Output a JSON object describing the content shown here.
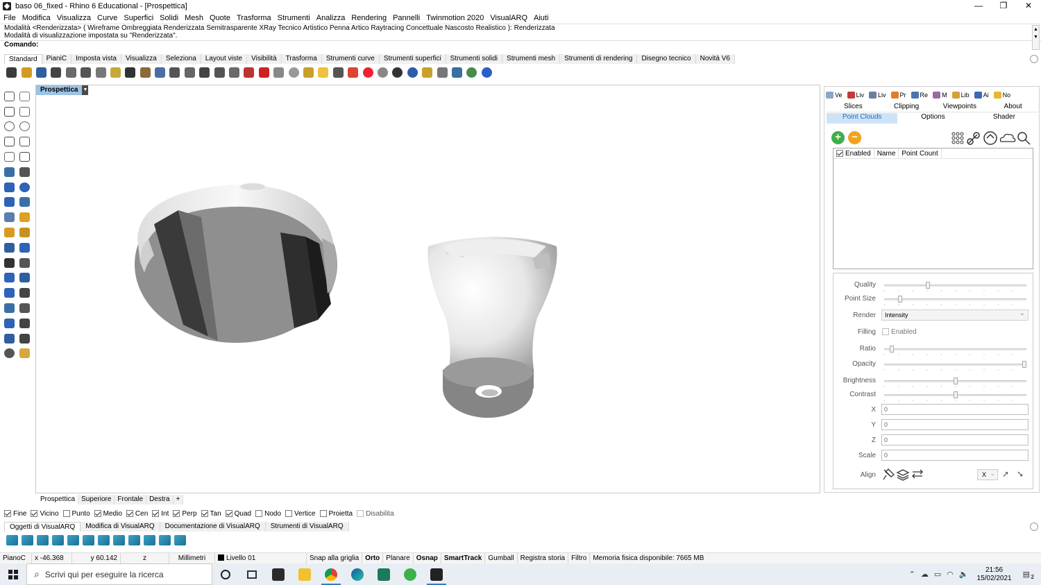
{
  "window": {
    "title": "baso 06_fixed - Rhino 6 Educational - [Prospettica]",
    "controls": [
      "—",
      "❐",
      "✕"
    ]
  },
  "menu": [
    "File",
    "Modifica",
    "Visualizza",
    "Curve",
    "Superfici",
    "Solidi",
    "Mesh",
    "Quote",
    "Trasforma",
    "Strumenti",
    "Analizza",
    "Rendering",
    "Pannelli",
    "Twinmotion 2020",
    "VisualARQ",
    "Aiuti"
  ],
  "command": {
    "history_line1": "Modalità <Renderizzata> ( Wireframe Ombreggiata Renderizzata Semitrasparente XRay Tecnico Artistico Penna Artico Raytracing Concettuale Nascosto Realistico ): Renderizzata",
    "history_line2": "Modalità di visualizzazione impostata su \"Renderizzata\".",
    "prompt": "Comando:"
  },
  "toolbar_tabs": [
    "Standard",
    "PianiC",
    "Imposta vista",
    "Visualizza",
    "Seleziona",
    "Layout viste",
    "Visibilità",
    "Trasforma",
    "Strumenti curve",
    "Strumenti superfici",
    "Strumenti solidi",
    "Strumenti mesh",
    "Strumenti di rendering",
    "Disegno tecnico",
    "Novità V6"
  ],
  "toolbar_icons": [
    "new-icon",
    "open-icon",
    "save-icon",
    "print-icon",
    "import-icon",
    "cut-icon",
    "copy-icon",
    "paste-icon",
    "undo-icon",
    "pan-icon",
    "move-view-icon",
    "zoom-icon",
    "zoom-window-icon",
    "zoom-extents-icon",
    "zoom-selected-icon",
    "rotate-view-icon",
    "grid-icon",
    "car-icon",
    "point-icon",
    "circle-icon",
    "light-icon",
    "bulb-icon",
    "lock-icon",
    "layer-icon",
    "color-wheel-icon",
    "sphere-gray-icon",
    "sphere-dark-icon",
    "sphere-blue-icon",
    "render-icon",
    "settings-icon",
    "gumball-icon",
    "globe-icon",
    "help-icon"
  ],
  "left_tool_icons": [
    "select-icon",
    "point-icon",
    "polyline-icon",
    "curve-icon",
    "circle-icon",
    "ellipse-icon",
    "triangle-icon",
    "rectangle-icon",
    "polygon-icon",
    "arc-icon",
    "box-edit-icon",
    "cut-icon",
    "box-icon",
    "sphere-icon",
    "cylinder-icon",
    "plane-icon",
    "surface-icon",
    "explode-icon",
    "fillet-icon",
    "chamfer-icon",
    "solid-icon",
    "boolean-icon",
    "curve-edit-icon",
    "curve-offset-icon",
    "text-icon",
    "dimension-icon",
    "group-icon",
    "block-icon",
    "solid-tool-icon",
    "measure-icon",
    "array-icon",
    "mirror-icon",
    "edit-icon",
    "check-icon",
    "render-sphere-icon",
    "material-icon"
  ],
  "viewport": {
    "title": "Prospettica",
    "tabs": [
      "Prospettica",
      "Superiore",
      "Frontale",
      "Destra"
    ],
    "add_tab": "+"
  },
  "panel": {
    "tabs": [
      {
        "label": "Ve",
        "color": "#8aa8c8"
      },
      {
        "label": "Liv",
        "color": "#c23b3b"
      },
      {
        "label": "Liv",
        "color": "#6a7fa0"
      },
      {
        "label": "Pr",
        "color": "#e07d2a"
      },
      {
        "label": "Re",
        "color": "#4a74b3"
      },
      {
        "label": "M",
        "color": "#9a6aa8"
      },
      {
        "label": "Lib",
        "color": "#d2a23a"
      },
      {
        "label": "Ai",
        "color": "#3a6ab3"
      },
      {
        "label": "No",
        "color": "#e8b631"
      }
    ],
    "subtabs_row1": [
      "Slices",
      "Clipping",
      "Viewpoints",
      "About"
    ],
    "subtabs_row2": [
      "Point Clouds",
      "Options",
      "Shader"
    ],
    "active_subtab": "Point Clouds",
    "add_label": "+",
    "remove_label": "−",
    "table_headers": [
      "Enabled",
      "Name",
      "Point Count"
    ],
    "properties": {
      "quality_label": "Quality",
      "quality_value": 0.3,
      "point_size_label": "Point Size",
      "point_size_value": 0.1,
      "render_label": "Render",
      "render_value": "Intensity",
      "filling_label": "Filling",
      "filling_enabled_label": "Enabled",
      "ratio_label": "Ratio",
      "ratio_value": 0.04,
      "opacity_label": "Opacity",
      "opacity_value": 1.0,
      "brightness_label": "Brightness",
      "brightness_value": 0.5,
      "contrast_label": "Contrast",
      "contrast_value": 0.5,
      "x_label": "X",
      "x_value": "0",
      "y_label": "Y",
      "y_value": "0",
      "z_label": "Z",
      "z_value": "0",
      "scale_label": "Scale",
      "scale_value": "0",
      "align_label": "Align",
      "align_axis": "X"
    }
  },
  "osnap": [
    {
      "label": "Fine",
      "checked": true
    },
    {
      "label": "Vicino",
      "checked": true
    },
    {
      "label": "Punto",
      "checked": false
    },
    {
      "label": "Medio",
      "checked": true
    },
    {
      "label": "Cen",
      "checked": true
    },
    {
      "label": "Int",
      "checked": true
    },
    {
      "label": "Perp",
      "checked": true
    },
    {
      "label": "Tan",
      "checked": true
    },
    {
      "label": "Quad",
      "checked": true
    },
    {
      "label": "Nodo",
      "checked": false
    },
    {
      "label": "Vertice",
      "checked": false
    },
    {
      "label": "Proietta",
      "checked": false
    },
    {
      "label": "Disabilita",
      "checked": false
    }
  ],
  "visualarq_tabs": [
    "Oggetti di VisualARQ",
    "Modifica di VisualARQ",
    "Documentazione di VisualARQ",
    "Strumenti di VisualARQ"
  ],
  "status": {
    "cplane": "PianoC",
    "x": "x -46.368",
    "y": "y 60.142",
    "z": "z",
    "units": "Millimetri",
    "layer": "Livello 01",
    "snap_grid": "Snap alla griglia",
    "ortho": "Orto",
    "planar": "Planare",
    "osnap": "Osnap",
    "smarttrack": "SmartTrack",
    "gumball": "Gumball",
    "history": "Registra storia",
    "filter": "Filtro",
    "memory": "Memoria fisica disponibile: 7665 MB"
  },
  "taskbar": {
    "search_placeholder": "Scrivi qui per eseguire la ricerca",
    "time": "21:56",
    "date": "15/02/2021",
    "notification_count": "2"
  }
}
